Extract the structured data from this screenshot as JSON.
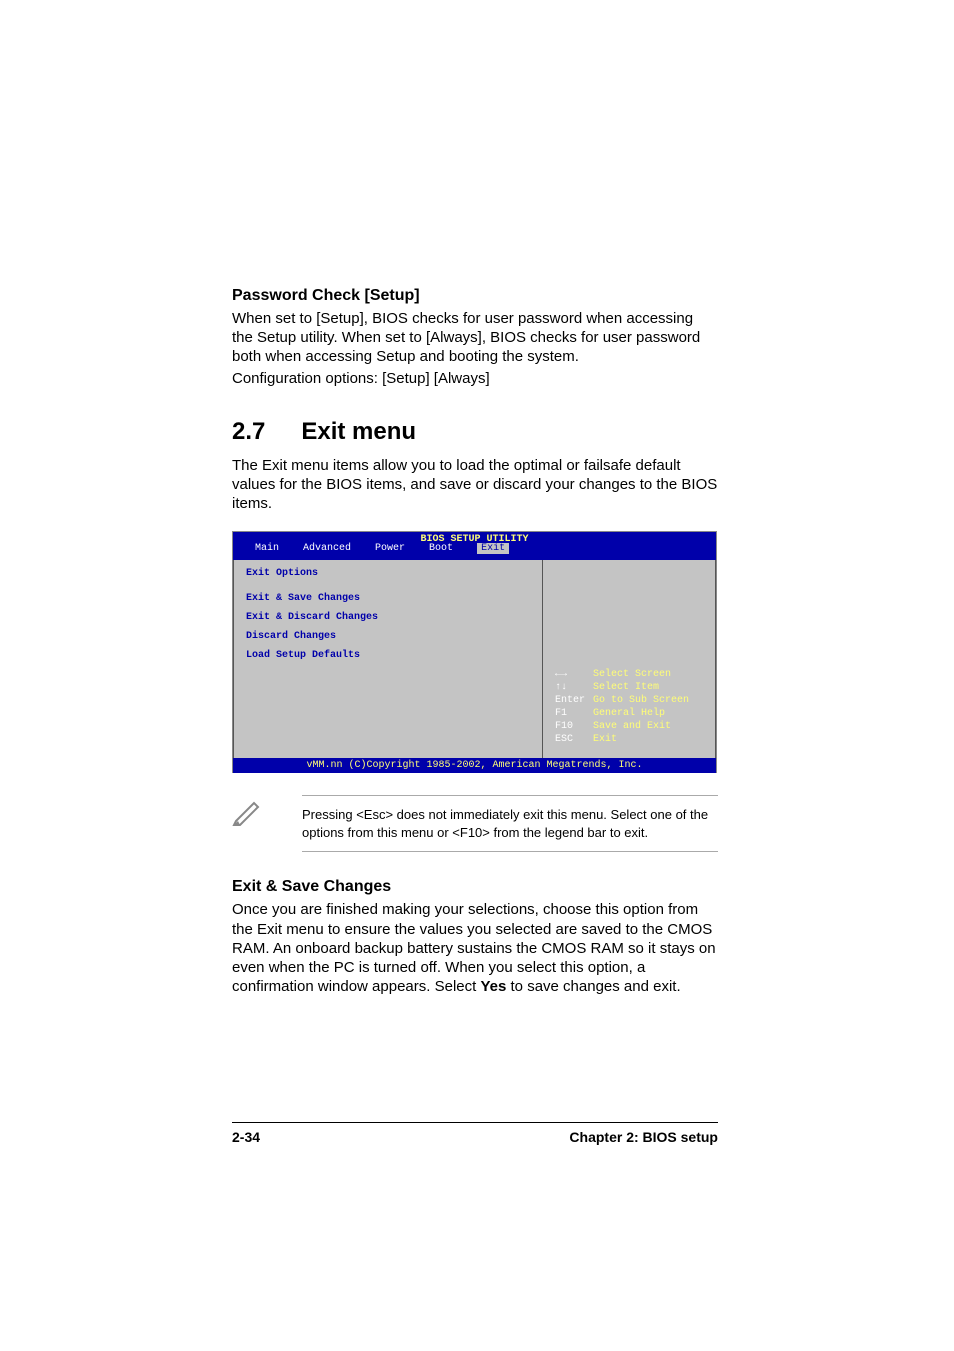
{
  "section1": {
    "heading": "Password Check [Setup]",
    "paragraph": "When set to [Setup], BIOS checks for user password when accessing the Setup utility. When set to [Always], BIOS checks for user password both when accessing Setup and booting the system.",
    "config": "Configuration options: [Setup] [Always]"
  },
  "section2": {
    "num": "2.7",
    "title": "Exit menu",
    "paragraph": "The Exit menu items allow you to load the optimal or failsafe default values for the BIOS items, and save or discard your changes to the BIOS items."
  },
  "bios": {
    "title": "BIOS SETUP UTILITY",
    "tabs": [
      "Main",
      "Advanced",
      "Power",
      "Boot",
      "Exit"
    ],
    "active_tab": "Exit",
    "heading": "Exit Options",
    "items": [
      "Exit & Save Changes",
      "Exit & Discard Changes",
      "Discard Changes",
      "",
      "Load Setup Defaults"
    ],
    "legend": [
      {
        "key": "←→",
        "label": "Select Screen"
      },
      {
        "key": "↑↓",
        "label": "Select Item"
      },
      {
        "key": "Enter",
        "label": "Go to Sub Screen"
      },
      {
        "key": "F1",
        "label": "General Help"
      },
      {
        "key": "F10",
        "label": "Save and Exit"
      },
      {
        "key": "ESC",
        "label": "Exit"
      }
    ],
    "footer": "vMM.nn (C)Copyright 1985-2002, American Megatrends, Inc."
  },
  "note": "Pressing <Esc> does not immediately exit this menu. Select one of the options from this menu or <F10> from the legend bar to exit.",
  "section3": {
    "heading": "Exit & Save Changes",
    "paragraph": "Once you are finished making your selections, choose this option from the Exit menu to ensure the values you selected are saved to the CMOS RAM. An onboard backup battery sustains the CMOS RAM so it stays on even when the PC is turned off. When you select this option, a confirmation window appears. Select ",
    "bold": "Yes",
    "tail": " to save changes and exit."
  },
  "footer": {
    "left": "2-34",
    "right": "Chapter 2: BIOS setup"
  }
}
